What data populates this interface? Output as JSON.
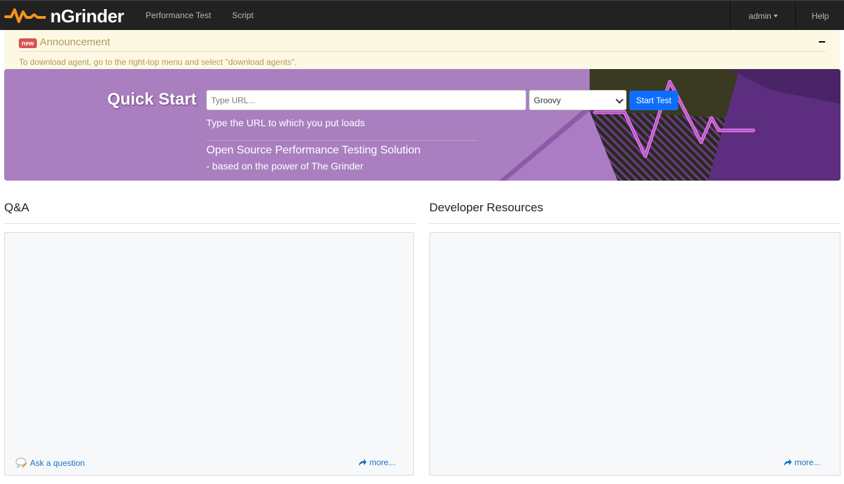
{
  "app": {
    "brand": "nGrinder",
    "colors": {
      "navbar": "#222222",
      "brand_orange": "#f7931e",
      "banner": "#a97fc0",
      "primary": "#0d6efd",
      "link": "#1a73c8",
      "announcement_bg": "#fcf8e3"
    }
  },
  "navbar": {
    "items": [
      {
        "label": "Performance Test"
      },
      {
        "label": "Script"
      }
    ],
    "user_menu": "admin",
    "help": "Help"
  },
  "announcement": {
    "badge": "new",
    "title": "Announcement",
    "collapse_icon": "minus",
    "text": "To download agent, go to the right-top menu and select \"download agents\"."
  },
  "quick_start": {
    "title": "Quick Start",
    "url_placeholder": "Type URL...",
    "script_type": "Groovy",
    "start_button": "Start Test",
    "hint": "Type the URL to which you put loads",
    "tagline": "Open Source Performance Testing Solution",
    "subtitle": "- based on the power of The Grinder"
  },
  "sections": {
    "qa": {
      "title": "Q&A",
      "ask_link": "Ask a question",
      "more_link": "more..."
    },
    "dev": {
      "title": "Developer Resources",
      "more_link": "more..."
    }
  }
}
